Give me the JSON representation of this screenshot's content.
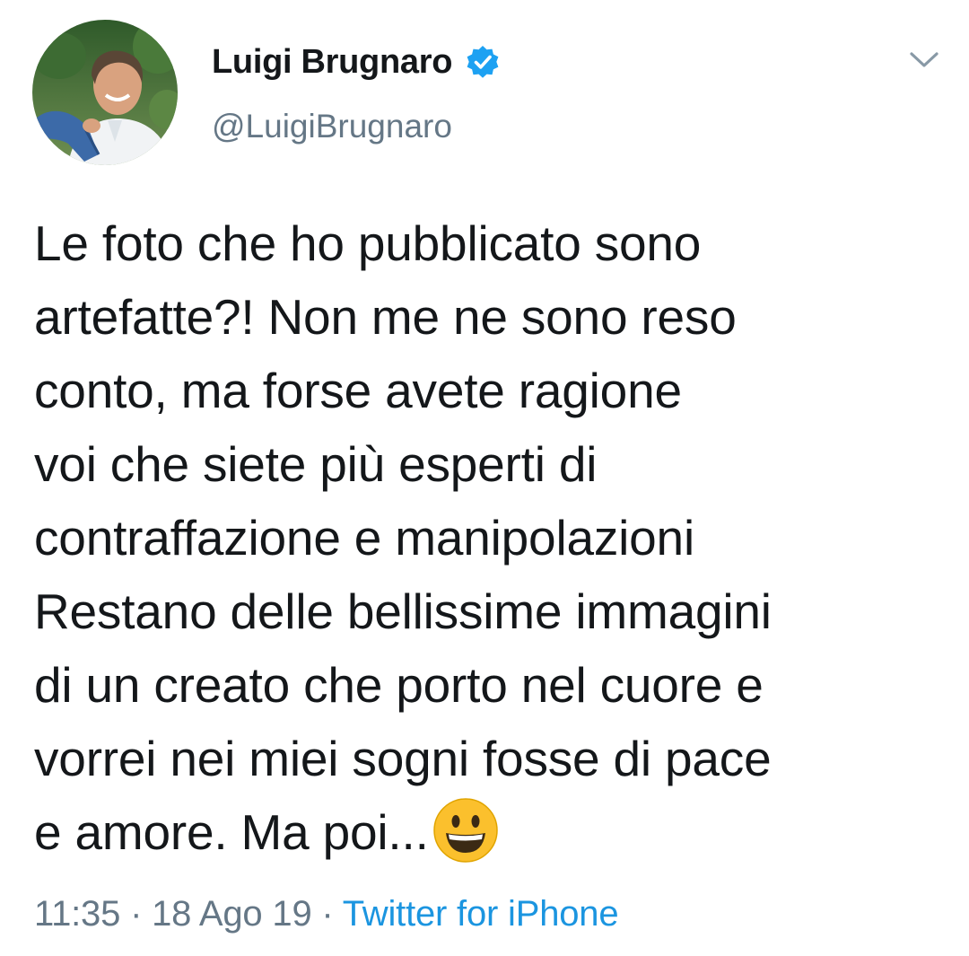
{
  "author": {
    "display_name": "Luigi Brugnaro",
    "handle": "@LuigiBrugnaro",
    "verified": true,
    "verified_color": "#1da1f2"
  },
  "tweet": {
    "text_lines": [
      "Le foto che ho pubblicato sono",
      "artefatte?! Non me ne sono reso",
      "conto, ma forse avete ragione",
      "voi che siete più esperti di",
      "contraffazione e manipolazioni",
      "Restano delle bellissime immagini",
      "di un creato che porto nel cuore e",
      "vorrei nei miei sogni fosse di pace",
      "e amore. Ma poi..."
    ],
    "trailing_emoji": "grinning-face-emoji",
    "time": "11:35",
    "separator": "·",
    "date": "18 Ago 19",
    "source": "Twitter for iPhone"
  },
  "colors": {
    "text": "#14171a",
    "secondary": "#657786",
    "link": "#1b95e0"
  }
}
